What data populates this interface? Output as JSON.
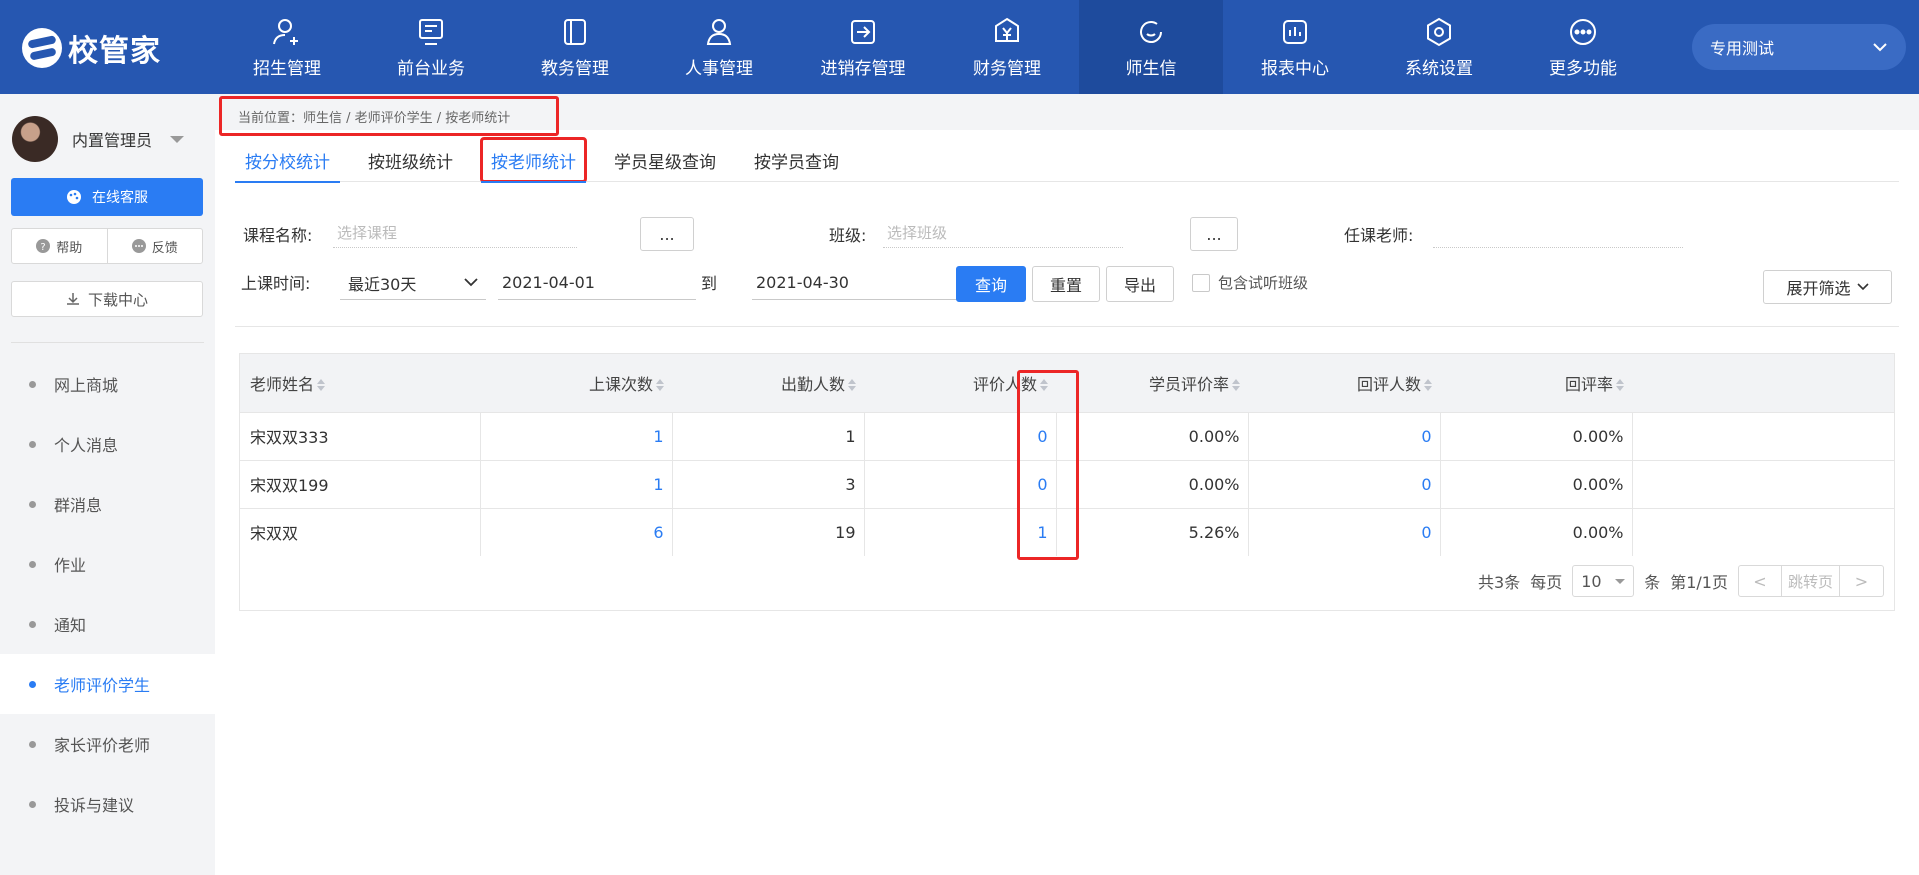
{
  "brand": {
    "name": "校管家"
  },
  "nav": [
    {
      "label": "招生管理",
      "icon": "user-add-icon"
    },
    {
      "label": "前台业务",
      "icon": "desk-icon"
    },
    {
      "label": "教务管理",
      "icon": "book-icon"
    },
    {
      "label": "人事管理",
      "icon": "person-icon"
    },
    {
      "label": "进销存管理",
      "icon": "inventory-icon"
    },
    {
      "label": "财务管理",
      "icon": "yuan-icon"
    },
    {
      "label": "师生信",
      "icon": "chat-icon",
      "active": true
    },
    {
      "label": "报表中心",
      "icon": "report-icon"
    },
    {
      "label": "系统设置",
      "icon": "settings-icon"
    },
    {
      "label": "更多功能",
      "icon": "more-icon"
    }
  ],
  "account_switch": {
    "label": "专用测试"
  },
  "sidebar": {
    "user_name": "内置管理员",
    "service_label": "在线客服",
    "help_label": "帮助",
    "feedback_label": "反馈",
    "download_label": "下载中心",
    "menu": [
      {
        "label": "网上商城"
      },
      {
        "label": "个人消息"
      },
      {
        "label": "群消息"
      },
      {
        "label": "作业"
      },
      {
        "label": "通知"
      },
      {
        "label": "老师评价学生",
        "active": true
      },
      {
        "label": "家长评价老师"
      },
      {
        "label": "投诉与建议"
      }
    ]
  },
  "breadcrumb": "当前位置：师生信 / 老师评价学生 / 按老师统计",
  "tabs": [
    {
      "label": "按分校统计",
      "active": true
    },
    {
      "label": "按班级统计"
    },
    {
      "label": "按老师统计",
      "active": true
    },
    {
      "label": "学员星级查询"
    },
    {
      "label": "按学员查询"
    }
  ],
  "filters": {
    "course_label": "课程名称:",
    "course_placeholder": "选择课程",
    "class_label": "班级:",
    "class_placeholder": "选择班级",
    "teacher_label": "任课老师:",
    "picker_label": "...",
    "time_label": "上课时间:",
    "time_range": "最近30天",
    "start_date": "2021-04-01",
    "to_label": "到",
    "end_date": "2021-04-30",
    "query_label": "查询",
    "reset_label": "重置",
    "export_label": "导出",
    "trial_label": "包含试听班级",
    "expand_label": "展开筛选"
  },
  "table": {
    "headers": [
      "老师姓名",
      "上课次数",
      "出勤人数",
      "评价人数",
      "学员评价率",
      "回评人数",
      "回评率"
    ],
    "rows": [
      [
        "宋双双333",
        "1",
        "1",
        "0",
        "0.00%",
        "0",
        "0.00%"
      ],
      [
        "宋双双199",
        "1",
        "3",
        "0",
        "0.00%",
        "0",
        "0.00%"
      ],
      [
        "宋双双",
        "6",
        "19",
        "1",
        "5.26%",
        "0",
        "0.00%"
      ]
    ]
  },
  "pager": {
    "total": "共3条",
    "per_page_label": "每页",
    "page_size": "10",
    "unit": "条",
    "page_info": "第1/1页",
    "jump_label": "跳转页",
    "prev": "<",
    "next": ">"
  },
  "colors": {
    "nav_bg": "#2657b1",
    "accent": "#2a7cf3",
    "highlight": "#ec2626"
  }
}
